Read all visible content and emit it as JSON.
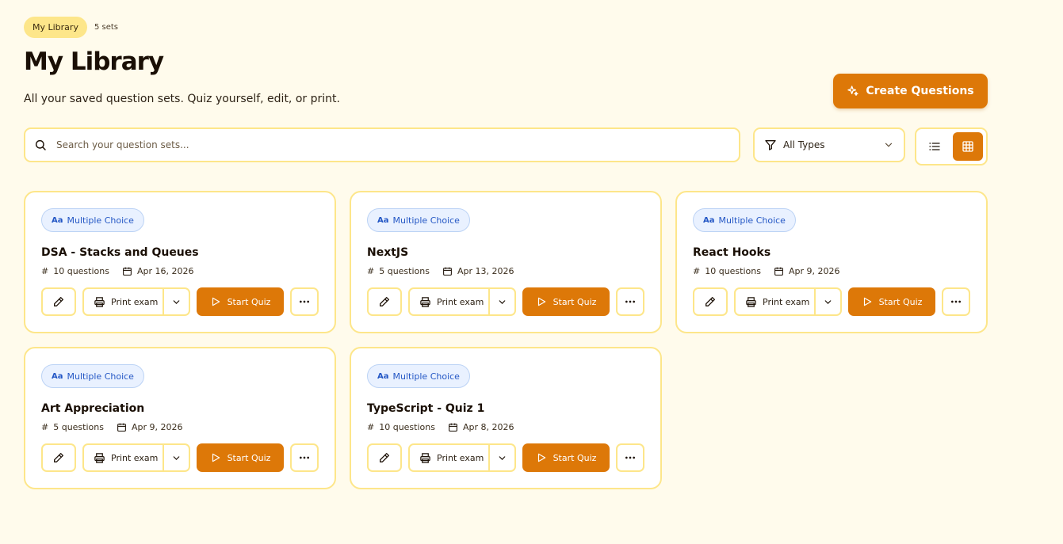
{
  "header": {
    "breadcrumb": "My Library",
    "count": "5 sets",
    "title": "My Library",
    "subtitle": "All your saved question sets. Quiz yourself, edit, or print.",
    "create_label": "Create Questions"
  },
  "search": {
    "placeholder": "Search your question sets..."
  },
  "filter": {
    "label": "All Types"
  },
  "colors": {
    "accent": "#dd7808",
    "border": "#fde68a",
    "background": "#fffbec",
    "tag": "#2457c5"
  },
  "cards": [
    {
      "tag": "Multiple Choice",
      "title": "DSA - Stacks and Queues",
      "questions": "10 questions",
      "date": "Apr 16, 2026",
      "print_label": "Print exam",
      "start_label": "Start Quiz"
    },
    {
      "tag": "Multiple Choice",
      "title": "NextJS",
      "questions": "5 questions",
      "date": "Apr 13, 2026",
      "print_label": "Print exam",
      "start_label": "Start Quiz"
    },
    {
      "tag": "Multiple Choice",
      "title": "React Hooks",
      "questions": "10 questions",
      "date": "Apr 9, 2026",
      "print_label": "Print exam",
      "start_label": "Start Quiz"
    },
    {
      "tag": "Multiple Choice",
      "title": "Art Appreciation",
      "questions": "5 questions",
      "date": "Apr 9, 2026",
      "print_label": "Print exam",
      "start_label": "Start Quiz"
    },
    {
      "tag": "Multiple Choice",
      "title": "TypeScript - Quiz 1",
      "questions": "10 questions",
      "date": "Apr 8, 2026",
      "print_label": "Print exam",
      "start_label": "Start Quiz"
    }
  ]
}
